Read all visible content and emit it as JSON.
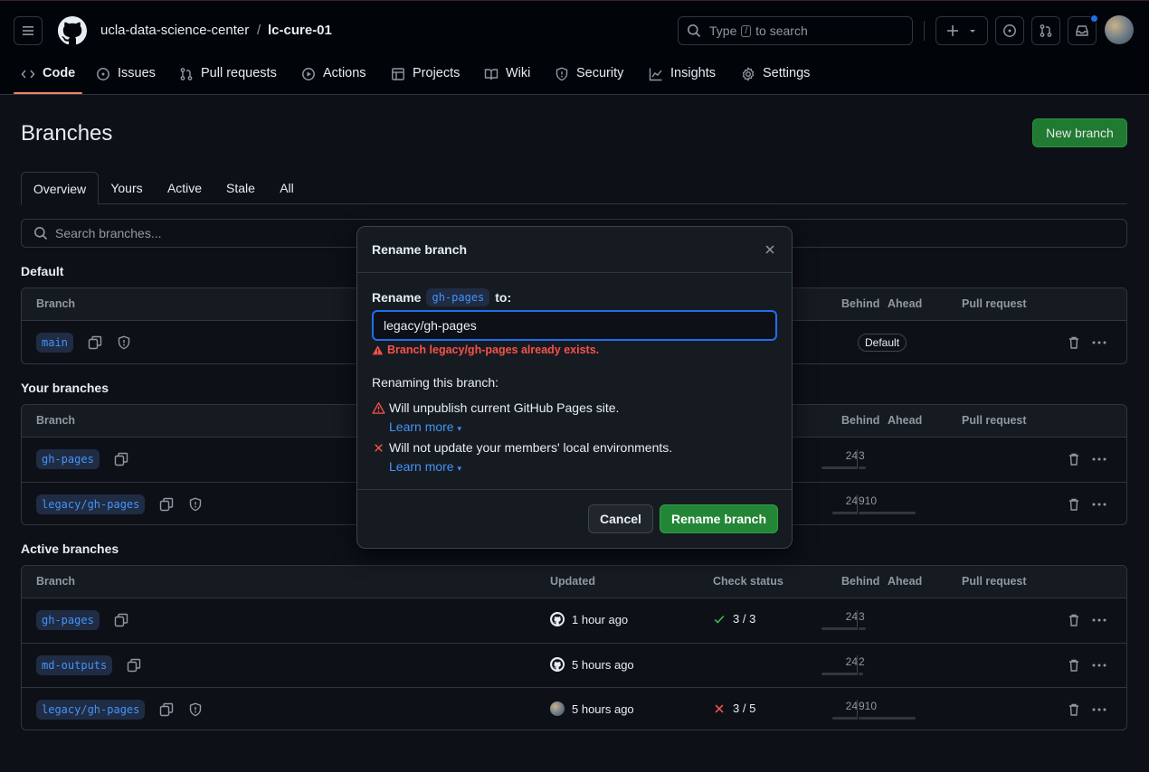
{
  "header": {
    "org": "ucla-data-science-center",
    "separator": "/",
    "repo": "lc-cure-01",
    "search_prefix": "Type",
    "search_key": "/",
    "search_suffix": "to search"
  },
  "repo_nav": [
    {
      "label": "Code",
      "icon": "code-icon",
      "selected": true
    },
    {
      "label": "Issues",
      "icon": "issue-icon"
    },
    {
      "label": "Pull requests",
      "icon": "pull-request-icon"
    },
    {
      "label": "Actions",
      "icon": "play-icon"
    },
    {
      "label": "Projects",
      "icon": "table-icon"
    },
    {
      "label": "Wiki",
      "icon": "book-icon"
    },
    {
      "label": "Security",
      "icon": "shield-icon"
    },
    {
      "label": "Insights",
      "icon": "graph-icon"
    },
    {
      "label": "Settings",
      "icon": "gear-icon"
    }
  ],
  "page": {
    "title": "Branches",
    "new_branch": "New branch",
    "tabs": [
      "Overview",
      "Yours",
      "Active",
      "Stale",
      "All"
    ],
    "search_placeholder": "Search branches..."
  },
  "columns": {
    "branch": "Branch",
    "updated": "Updated",
    "check_status": "Check status",
    "behind": "Behind",
    "ahead": "Ahead",
    "pull_request": "Pull request"
  },
  "sections": {
    "default": {
      "title": "Default",
      "rows": [
        {
          "name": "main",
          "badge": "Default"
        }
      ]
    },
    "yours": {
      "title": "Your branches",
      "rows": [
        {
          "name": "gh-pages",
          "behind": "24",
          "ahead": "3"
        },
        {
          "name": "legacy/gh-pages",
          "behind": "24",
          "ahead": "910"
        }
      ]
    },
    "active": {
      "title": "Active branches",
      "rows": [
        {
          "name": "gh-pages",
          "updated": "1 hour ago",
          "check": "3 / 3",
          "check_state": "success",
          "behind": "24",
          "ahead": "3"
        },
        {
          "name": "md-outputs",
          "updated": "5 hours ago",
          "check": "",
          "behind": "24",
          "ahead": "2"
        },
        {
          "name": "legacy/gh-pages",
          "updated": "5 hours ago",
          "check": "3 / 5",
          "check_state": "failure",
          "behind": "24",
          "ahead": "910"
        }
      ]
    }
  },
  "dialog": {
    "title": "Rename branch",
    "label_prefix": "Rename",
    "label_branch": "gh-pages",
    "label_suffix": "to:",
    "input_value": "legacy/gh-pages",
    "error": "Branch legacy/gh-pages already exists.",
    "intro": "Renaming this branch:",
    "warning_1": "Will unpublish current GitHub Pages site.",
    "warning_2": "Will not update your members' local environments.",
    "learn_more": "Learn more",
    "cancel": "Cancel",
    "confirm": "Rename branch"
  },
  "colors": {
    "accent": "#4493f8",
    "success": "#238636",
    "danger": "#f85149",
    "selected_underline": "#f78166"
  }
}
